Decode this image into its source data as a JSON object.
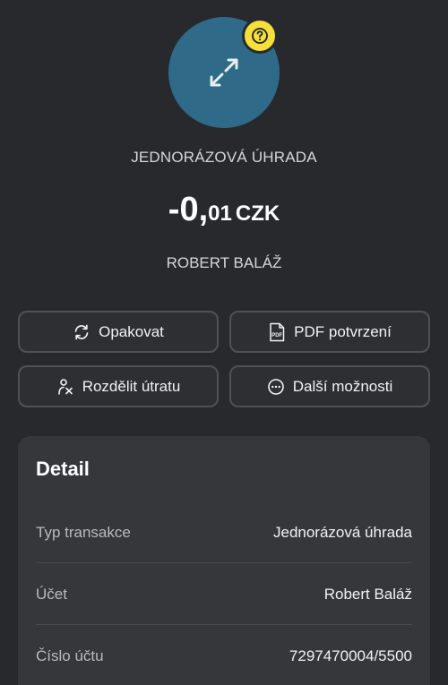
{
  "transaction": {
    "type": "JEDNORÁZOVÁ ÚHRADA",
    "amount_integer": "-0,",
    "amount_decimal": "01",
    "currency": "CZK",
    "counterparty": "ROBERT BALÁŽ",
    "avatar_icon": "transfer-arrows-icon",
    "badge_icon": "question-mark-icon"
  },
  "actions": {
    "repeat": {
      "label": "Opakovat",
      "icon": "refresh-icon"
    },
    "pdf": {
      "label": "PDF potvrzení",
      "icon": "pdf-icon"
    },
    "split": {
      "label": "Rozdělit útratu",
      "icon": "split-person-icon"
    },
    "more": {
      "label": "Další možnosti",
      "icon": "more-dots-icon"
    }
  },
  "detail": {
    "title": "Detail",
    "rows": [
      {
        "label": "Typ transakce",
        "value": "Jednorázová úhrada"
      },
      {
        "label": "Účet",
        "value": "Robert Baláž"
      },
      {
        "label": "Číslo účtu",
        "value": "7297470004/5500"
      }
    ]
  },
  "colors": {
    "background": "#28292d",
    "avatar": "#2f6a89",
    "badge": "#f4df3c",
    "card": "#36373b"
  }
}
